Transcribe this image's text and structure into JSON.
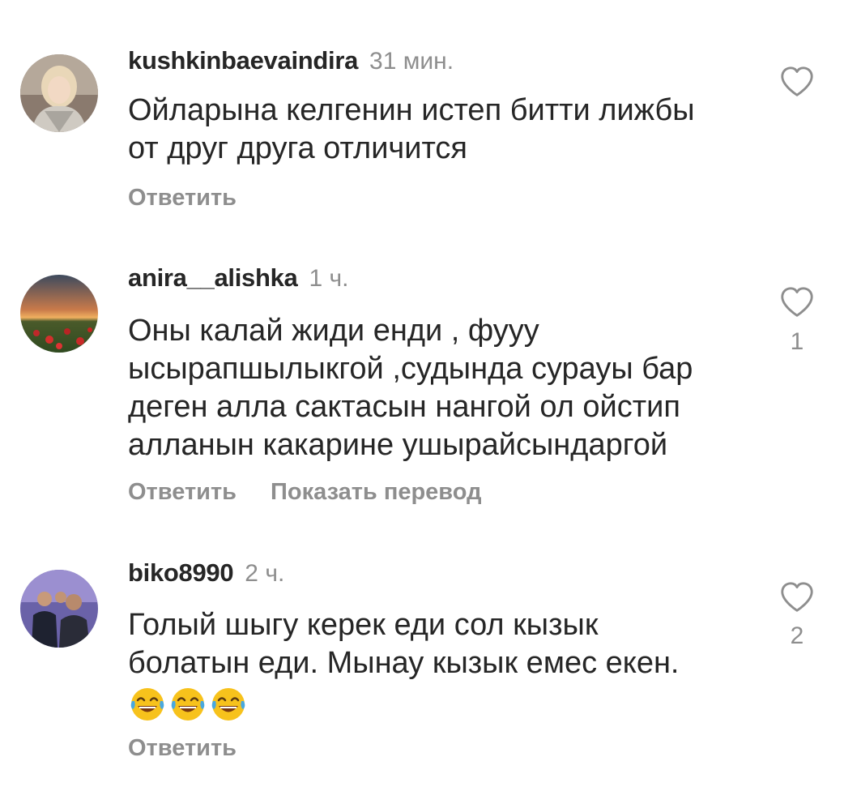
{
  "comments": [
    {
      "username": "kushkinbaevaindira",
      "time": "31 мин.",
      "lines": [
        "Ойларына келгенин истеп битти лижбы",
        "от друг друга отличится"
      ],
      "reply": "Ответить",
      "likes": ""
    },
    {
      "username": "anira__alishka",
      "time": "1 ч.",
      "lines": [
        "Оны калай жиди енди , фууу",
        "ысырапшылыкгой ,судында сурауы бар",
        "деген алла сактасын нангой ол  ойстип",
        "алланын какарине ушырайсындаргой"
      ],
      "reply": "Ответить",
      "translate": "Показать перевод",
      "likes": "1"
    },
    {
      "username": "biko8990",
      "time": "2 ч.",
      "lines": [
        "Голый шыгу керек еди сол кызык",
        "болатын еди. Мынау кызык емес екен."
      ],
      "emojis": [
        "face-with-tears-of-joy-icon",
        "face-with-tears-of-joy-icon",
        "face-with-tears-of-joy-icon"
      ],
      "reply": "Ответить",
      "likes": "2"
    }
  ],
  "colors": {
    "text": "#262626",
    "secondary": "#8e8e8e",
    "emoji": "#f7c21c"
  }
}
